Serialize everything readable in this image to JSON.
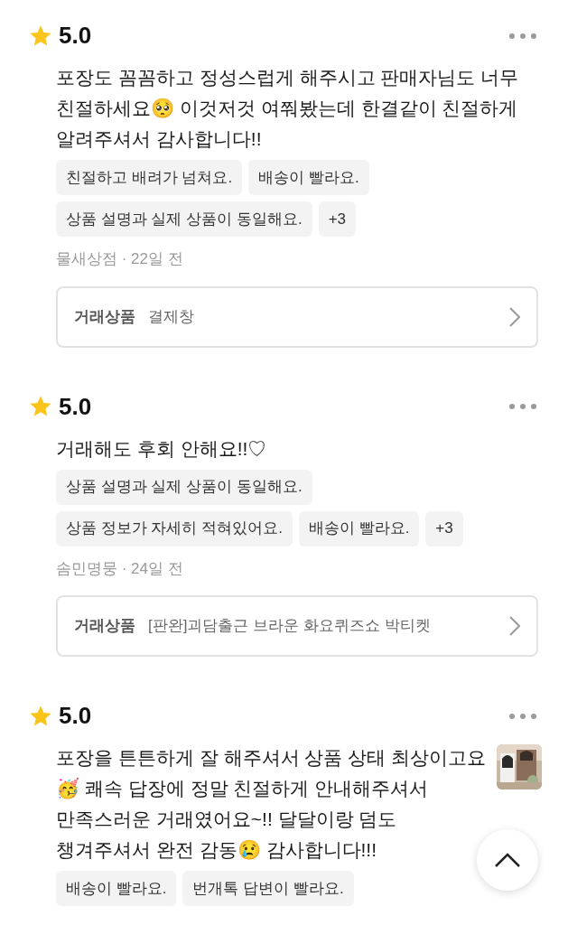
{
  "reviews": [
    {
      "rating": "5.0",
      "text": "포장도 꼼꼼하고 정성스럽게 해주시고 판매자님도 너무\n친절하세요🥺 이것저것 여쭤봤는데 한결같이 친절하게\n알려주셔서 감사합니다!!",
      "tags": [
        "친절하고 배려가 넘쳐요.",
        "배송이 빨라요.",
        "상품 설명과 실제 상품이 동일해요.",
        "+3"
      ],
      "meta": "물새상점 · 22일 전",
      "product": {
        "label": "거래상품",
        "name": "결제창"
      }
    },
    {
      "rating": "5.0",
      "text": "거래해도 후회 안해요!!♡",
      "tags": [
        "상품 설명과 실제 상품이 동일해요.",
        "상품 정보가 자세히 적혀있어요.",
        "배송이 빨라요.",
        "+3"
      ],
      "meta": "솜민명뭉 · 24일 전",
      "product": {
        "label": "거래상품",
        "name": "[판완]괴담출근 브라운 화요퀴즈쇼 박티켓"
      }
    },
    {
      "rating": "5.0",
      "text": "포장을 튼튼하게 잘 해주셔서 상품 상태 최상이고요\n🥳 쾌속 답장에 정말 친절하게 안내해주셔서\n만족스러운 거래였어요~!! 달달이랑 덤도\n챙겨주셔서 완전 감동😢 감사합니다!!!",
      "thumbnail": {
        "kind": "picture"
      },
      "tags": [
        "배송이 빨라요.",
        "번개톡 답변이 빨라요."
      ]
    }
  ]
}
